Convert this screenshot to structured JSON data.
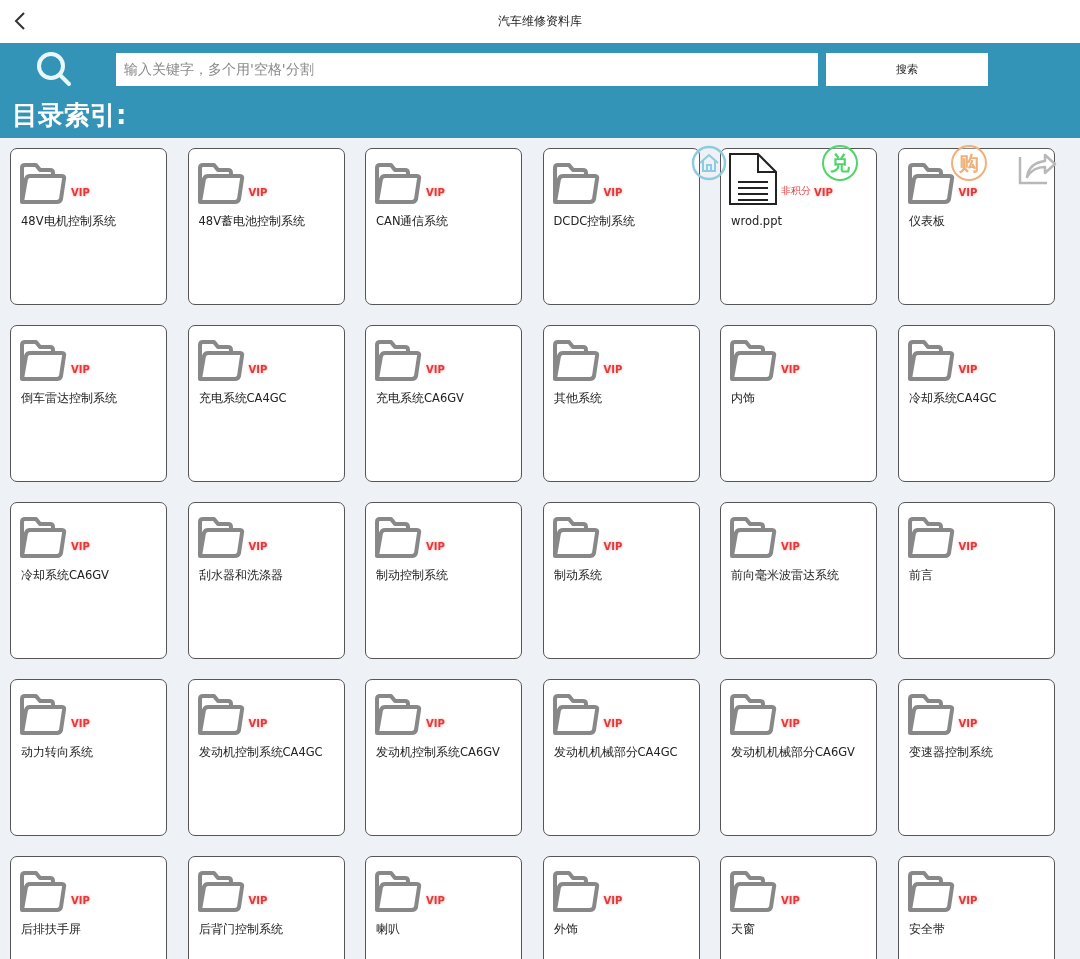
{
  "header": {
    "title": "汽车维修资料库"
  },
  "search": {
    "placeholder": "输入关键字，多个用'空格'分割",
    "button": "搜索"
  },
  "section_title": "目录索引:",
  "items": [
    {
      "name": "48V电机控制系统",
      "kind": "folder",
      "badge": "VIP"
    },
    {
      "name": "48V蓄电池控制系统",
      "kind": "folder",
      "badge": "VIP"
    },
    {
      "name": "CAN通信系统",
      "kind": "folder",
      "badge": "VIP"
    },
    {
      "name": "DCDC控制系统",
      "kind": "folder",
      "badge": "VIP"
    },
    {
      "name": "wrod.ppt",
      "kind": "file",
      "tag": "非积分",
      "badge": "VIP"
    },
    {
      "name": "仪表板",
      "kind": "folder",
      "badge": "VIP"
    },
    {
      "name": "倒车雷达控制系统",
      "kind": "folder",
      "badge": "VIP"
    },
    {
      "name": "充电系统CA4GC",
      "kind": "folder",
      "badge": "VIP"
    },
    {
      "name": "充电系统CA6GV",
      "kind": "folder",
      "badge": "VIP"
    },
    {
      "name": "其他系统",
      "kind": "folder",
      "badge": "VIP"
    },
    {
      "name": "内饰",
      "kind": "folder",
      "badge": "VIP"
    },
    {
      "name": "冷却系统CA4GC",
      "kind": "folder",
      "badge": "VIP"
    },
    {
      "name": "冷却系统CA6GV",
      "kind": "folder",
      "badge": "VIP"
    },
    {
      "name": "刮水器和洗涤器",
      "kind": "folder",
      "badge": "VIP"
    },
    {
      "name": "制动控制系统",
      "kind": "folder",
      "badge": "VIP"
    },
    {
      "name": "制动系统",
      "kind": "folder",
      "badge": "VIP"
    },
    {
      "name": "前向毫米波雷达系统",
      "kind": "folder",
      "badge": "VIP"
    },
    {
      "name": "前言",
      "kind": "folder",
      "badge": "VIP"
    },
    {
      "name": "动力转向系统",
      "kind": "folder",
      "badge": "VIP"
    },
    {
      "name": "发动机控制系统CA4GC",
      "kind": "folder",
      "badge": "VIP"
    },
    {
      "name": "发动机控制系统CA6GV",
      "kind": "folder",
      "badge": "VIP"
    },
    {
      "name": "发动机机械部分CA4GC",
      "kind": "folder",
      "badge": "VIP"
    },
    {
      "name": "发动机机械部分CA6GV",
      "kind": "folder",
      "badge": "VIP"
    },
    {
      "name": "变速器控制系统",
      "kind": "folder",
      "badge": "VIP"
    },
    {
      "name": "后排扶手屏",
      "kind": "folder",
      "badge": "VIP"
    },
    {
      "name": "后背门控制系统",
      "kind": "folder",
      "badge": "VIP"
    },
    {
      "name": "喇叭",
      "kind": "folder",
      "badge": "VIP"
    },
    {
      "name": "外饰",
      "kind": "folder",
      "badge": "VIP"
    },
    {
      "name": "天窗",
      "kind": "folder",
      "badge": "VIP"
    },
    {
      "name": "安全带",
      "kind": "folder",
      "badge": "VIP"
    }
  ],
  "floating_actions": [
    {
      "kind": "home",
      "color": "#8fcbe0"
    },
    {
      "kind": "text",
      "label": "兑",
      "color": "#4fd66a"
    },
    {
      "kind": "text",
      "label": "购",
      "color": "#f0b07a"
    },
    {
      "kind": "share",
      "color": "#b8b8b8"
    }
  ]
}
